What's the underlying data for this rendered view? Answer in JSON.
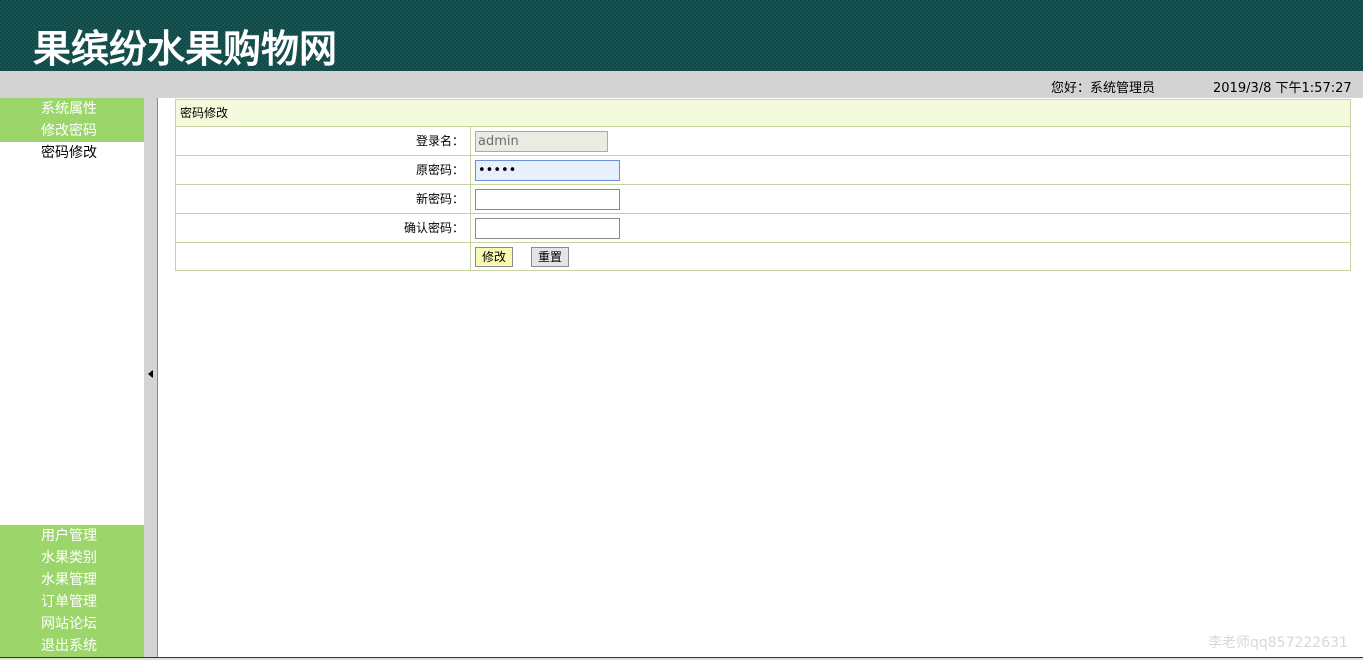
{
  "header": {
    "title": "果缤纷水果购物网"
  },
  "status": {
    "greeting": "您好：系统管理员",
    "datetime": "2019/3/8 下午1:57:27"
  },
  "sidebar": {
    "top_items": [
      {
        "label": "系统属性"
      },
      {
        "label": "修改密码"
      }
    ],
    "sub_item": "密码修改",
    "bottom_items": [
      {
        "label": "用户管理"
      },
      {
        "label": "水果类别"
      },
      {
        "label": "水果管理"
      },
      {
        "label": "订单管理"
      },
      {
        "label": "网站论坛"
      },
      {
        "label": "退出系统"
      }
    ]
  },
  "form": {
    "title": "密码修改",
    "fields": {
      "login": {
        "label": "登录名：",
        "value": "admin"
      },
      "old_password": {
        "label": "原密码：",
        "value": "•••••"
      },
      "new_password": {
        "label": "新密码：",
        "value": ""
      },
      "confirm_password": {
        "label": "确认密码：",
        "value": ""
      }
    },
    "submit_label": "修改",
    "reset_label": "重置"
  },
  "watermark": "李老师qq857222631",
  "colors": {
    "header_bg": "#0e4a48",
    "sidebar_item_bg": "#9cd66a",
    "panel_head_bg": "#f4fbdc",
    "status_bg": "#d3d3d3"
  }
}
